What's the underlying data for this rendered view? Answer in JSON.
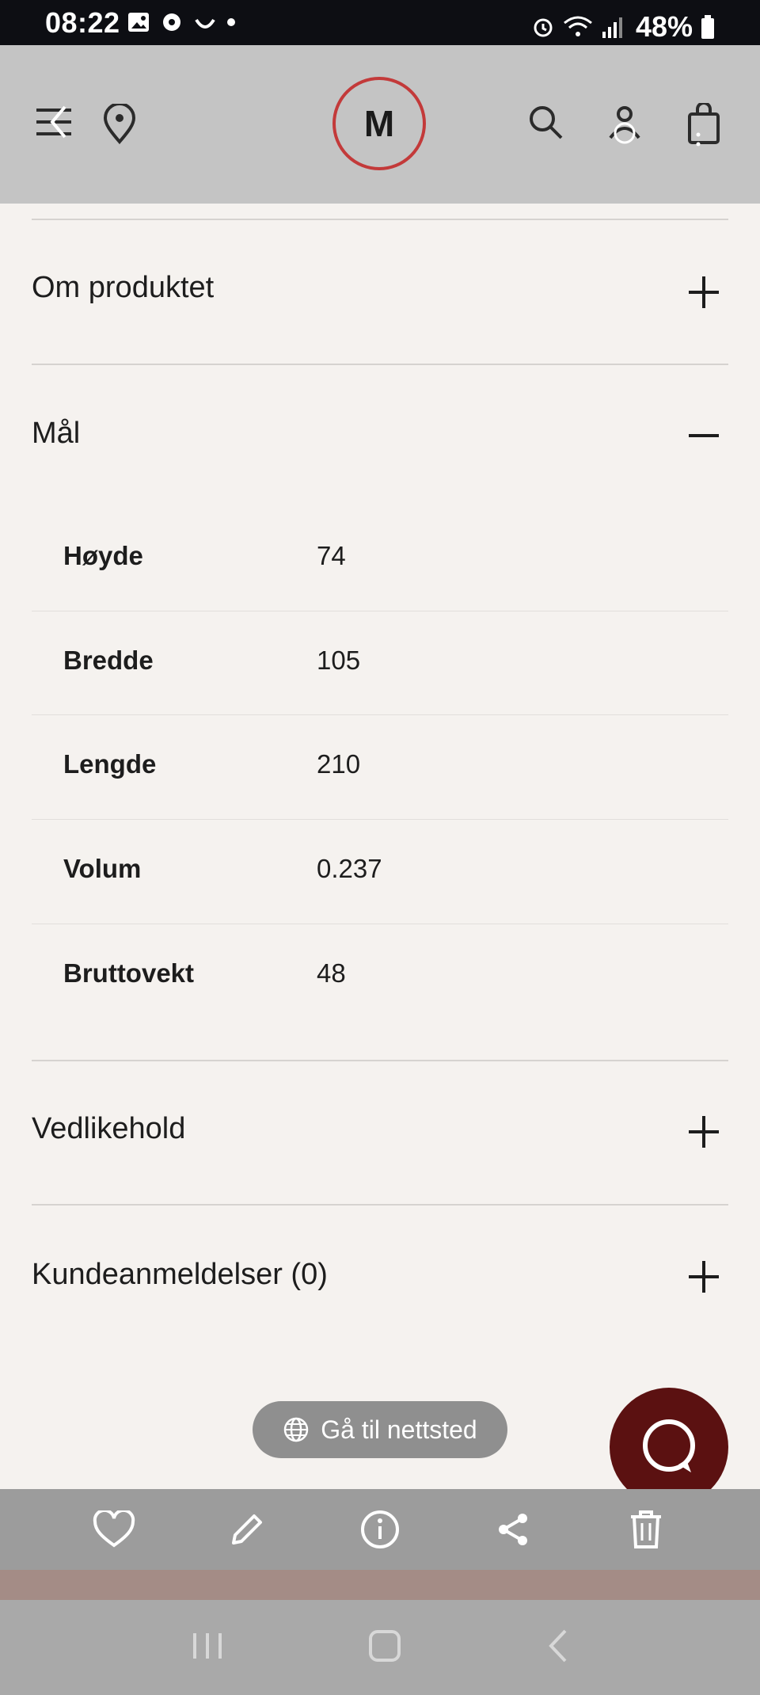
{
  "status_bar": {
    "time": "08:22",
    "battery": "48%"
  },
  "header": {
    "logo_letter": "M",
    "accent_color": "#c33a3a"
  },
  "accordion": {
    "about": {
      "title": "Om produktet",
      "expanded": false
    },
    "dimensions": {
      "title": "Mål",
      "expanded": true,
      "rows": [
        {
          "label": "Høyde",
          "value": "74"
        },
        {
          "label": "Bredde",
          "value": "105"
        },
        {
          "label": "Lengde",
          "value": "210"
        },
        {
          "label": "Volum",
          "value": "0.237"
        },
        {
          "label": "Bruttovekt",
          "value": "48"
        }
      ]
    },
    "maintenance": {
      "title": "Vedlikehold",
      "expanded": false
    },
    "reviews": {
      "title": "Kundeanmeldelser (0)",
      "expanded": false
    }
  },
  "goto_site": {
    "label": "Gå til nettsted"
  },
  "toolbar_icons": [
    "heart-icon",
    "pencil-icon",
    "info-icon",
    "share-icon",
    "trash-icon"
  ],
  "fab_color": "#5b1111"
}
